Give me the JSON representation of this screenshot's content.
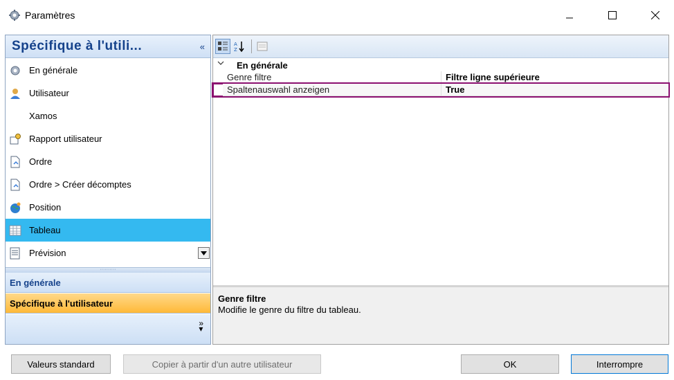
{
  "window": {
    "title": "Paramètres",
    "icon": "gear-icon"
  },
  "left": {
    "header_title": "Spécifique à l'utili...",
    "collapse_glyph": "«",
    "items": [
      {
        "label": "En générale",
        "icon": "gear-icon"
      },
      {
        "label": "Utilisateur",
        "icon": "user-icon"
      },
      {
        "label": "Xamos",
        "icon": ""
      },
      {
        "label": "Rapport utilisateur",
        "icon": "report-icon"
      },
      {
        "label": "Ordre",
        "icon": "document-icon"
      },
      {
        "label": "Ordre > Créer décomptes",
        "icon": "document-icon"
      },
      {
        "label": "Position",
        "icon": "globe-icon"
      },
      {
        "label": "Tableau",
        "icon": "table-icon"
      },
      {
        "label": "Prévision",
        "icon": "forecast-icon"
      }
    ],
    "selected_index": 7,
    "sections": [
      {
        "label": "En générale"
      },
      {
        "label": "Spécifique à l'utilisateur"
      }
    ],
    "more_glyph": "»"
  },
  "property_grid": {
    "category": "En générale",
    "rows": [
      {
        "name": "Genre filtre",
        "value": "Filtre ligne supérieure"
      },
      {
        "name": "Spaltenauswahl anzeigen",
        "value": "True"
      }
    ],
    "description_title": "Genre filtre",
    "description_text": "Modifie le genre du filtre du tableau."
  },
  "buttons": {
    "standard": "Valeurs standard",
    "copy": "Copier à partir d'un autre utilisateur",
    "ok": "OK",
    "abort": "Interrompre"
  },
  "colors": {
    "selection": "#34b9f0",
    "highlight_border": "#8b1070",
    "active_section": "#ffb938",
    "header_text": "#15428b"
  }
}
